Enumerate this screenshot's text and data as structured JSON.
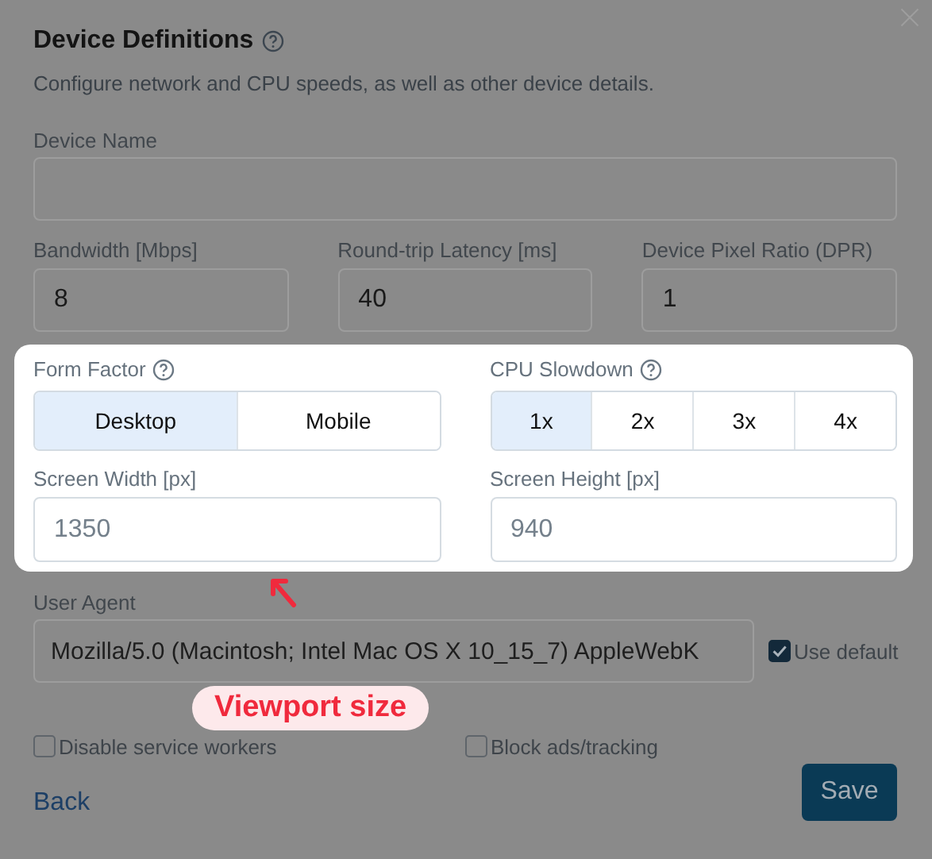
{
  "dialog": {
    "title": "Device Definitions",
    "subtitle": "Configure network and CPU speeds, as well as other device details."
  },
  "device_name": {
    "label": "Device Name"
  },
  "metrics": [
    {
      "label": "Bandwidth [Mbps]",
      "value": "8"
    },
    {
      "label": "Round-trip Latency [ms]",
      "value": "40"
    },
    {
      "label": "Device Pixel Ratio (DPR)",
      "value": "1"
    }
  ],
  "form_factor": {
    "label": "Form Factor",
    "options": [
      {
        "label": "Desktop",
        "selected": true
      },
      {
        "label": "Mobile",
        "selected": false
      }
    ]
  },
  "cpu_slowdown": {
    "label": "CPU Slowdown",
    "options": [
      {
        "label": "1x",
        "selected": true
      },
      {
        "label": "2x",
        "selected": false
      },
      {
        "label": "3x",
        "selected": false
      },
      {
        "label": "4x",
        "selected": false
      }
    ]
  },
  "screen": [
    {
      "label": "Screen Width [px]",
      "value": "1350"
    },
    {
      "label": "Screen Height [px]",
      "value": "940"
    }
  ],
  "user_agent": {
    "label": "User Agent",
    "value": "Mozilla/5.0 (Macintosh; Intel Mac OS X 10_15_7) AppleWebK",
    "use_default": {
      "label": "Use default",
      "checked": true
    }
  },
  "options": [
    {
      "label": "Disable service workers",
      "checked": false
    },
    {
      "label": "Block ads/tracking",
      "checked": false
    }
  ],
  "footer": {
    "back": "Back",
    "save": "Save"
  },
  "annotation": {
    "label": "Viewport size"
  }
}
